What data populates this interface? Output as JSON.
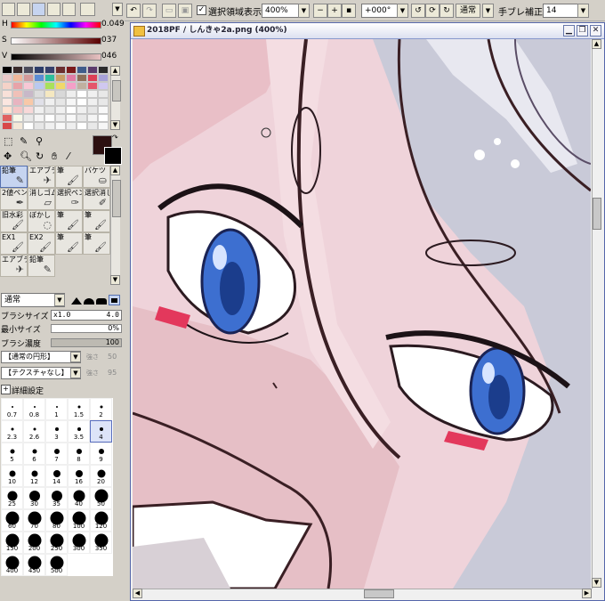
{
  "left_panel": {
    "hsv": [
      {
        "label": "H",
        "value": "0.049"
      },
      {
        "label": "S",
        "value": "037"
      },
      {
        "label": "V",
        "value": "046"
      }
    ],
    "tools": [
      {
        "label": "鉛筆",
        "icon": "pencil-icon",
        "selected": true
      },
      {
        "label": "エアブラシ",
        "icon": "airbrush-icon"
      },
      {
        "label": "筆",
        "icon": "brush-icon"
      },
      {
        "label": "バケツ",
        "icon": "bucket-icon"
      },
      {
        "label": "2値ペン",
        "icon": "binary-pen-icon"
      },
      {
        "label": "消しゴム",
        "icon": "eraser-icon"
      },
      {
        "label": "選択ペン",
        "icon": "select-pen-icon"
      },
      {
        "label": "選択消し",
        "icon": "select-eraser-icon"
      },
      {
        "label": "旧水彩",
        "icon": "old-watercolor-icon"
      },
      {
        "label": "ぼかし",
        "icon": "blur-icon"
      },
      {
        "label": "筆",
        "icon": "brush-icon"
      },
      {
        "label": "筆",
        "icon": "brush-icon"
      },
      {
        "label": "EX1",
        "icon": "brush-icon"
      },
      {
        "label": "EX2",
        "icon": "brush-icon"
      },
      {
        "label": "筆",
        "icon": "brush-icon"
      },
      {
        "label": "筆",
        "icon": "brush-icon"
      },
      {
        "label": "エアブラシ",
        "icon": "airbrush-icon"
      },
      {
        "label": "鉛筆",
        "icon": "pencil-icon"
      }
    ],
    "blend_mode": "通常",
    "brush_size": {
      "label": "ブラシサイズ",
      "multiplier": "x1.0",
      "value": "4.0"
    },
    "min_size": {
      "label": "最小サイズ",
      "value": "0%"
    },
    "density": {
      "label": "ブラシ濃度",
      "value": "100"
    },
    "shape": {
      "value": "【通常の円形】",
      "param_label": "強さ",
      "param_value": "50"
    },
    "texture": {
      "value": "【テクスチャなし】",
      "param_label": "強さ",
      "param_value": "95"
    },
    "advanced_settings": "詳細設定",
    "sizes": [
      "0.7",
      "0.8",
      "1",
      "1.5",
      "2",
      "2.3",
      "2.6",
      "3",
      "3.5",
      "4",
      "5",
      "6",
      "7",
      "8",
      "9",
      "10",
      "12",
      "14",
      "16",
      "20",
      "25",
      "30",
      "35",
      "40",
      "50",
      "60",
      "70",
      "80",
      "100",
      "120",
      "150",
      "200",
      "250",
      "300",
      "350",
      "400",
      "450",
      "500"
    ],
    "selected_size": "4"
  },
  "toolbar": {
    "selection_display_label": "選択領域表示",
    "zoom": "400%",
    "rotation": "+000°",
    "blend": "通常",
    "stabilizer_label": "手ブレ補正",
    "stabilizer_value": "14"
  },
  "document": {
    "title": "2018PF / しんきゃ2a.png (400%)"
  }
}
